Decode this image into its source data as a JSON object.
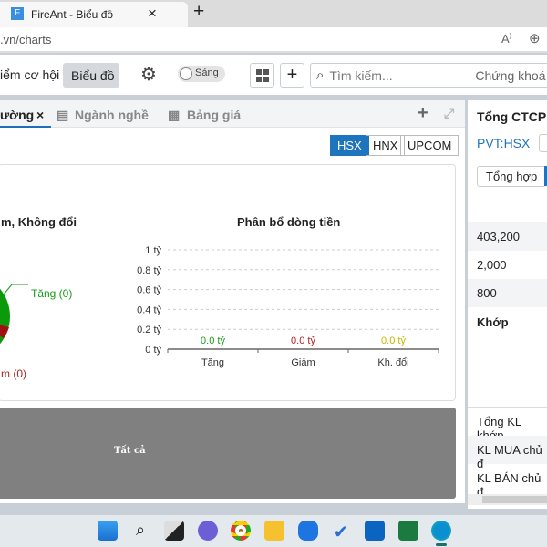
{
  "browser": {
    "tab_title": "FireAnt - Biểu đồ",
    "url": ".vn/charts",
    "new_tab": "+",
    "close": "×",
    "favicon": "F"
  },
  "toolbar": {
    "nav_partial": "iểm cơ hội",
    "chart_btn": "Biểu đồ",
    "theme_toggle": "Sáng",
    "add": "+",
    "search_placeholder": "Tìm kiếm...",
    "right_partial": "Chứng khoá"
  },
  "panel": {
    "tabs": [
      {
        "label": "ường"
      },
      {
        "label": "Ngành nghề"
      },
      {
        "label": "Bảng giá"
      }
    ],
    "exchanges": [
      "HSX",
      "HNX",
      "UPCOM"
    ],
    "active_exchange": "HSX"
  },
  "pie": {
    "title_partial": "m, Không đổi",
    "label_up": "Tăng (0)",
    "label_down": "m (0)"
  },
  "chart_data": {
    "type": "bar",
    "title": "Phân bổ dòng tiền",
    "categories": [
      "Tăng",
      "Giảm",
      "Kh. đổi"
    ],
    "values": [
      0,
      0,
      0
    ],
    "data_labels": [
      "0.0 tỷ",
      "0.0 tỷ",
      "0.0 tỷ"
    ],
    "colors": [
      "#1a9a1a",
      "#b22222",
      "#c8b400"
    ],
    "yticks": [
      "0 tỷ",
      "0.2 tỷ",
      "0.4 tỷ",
      "0.6 tỷ",
      "0.8 tỷ",
      "1 tỷ"
    ],
    "ylim": [
      0,
      1
    ]
  },
  "bottom": {
    "label": "Tất cả"
  },
  "right": {
    "title": "Tổng CTCP",
    "symbol": "PVT:HSX",
    "tab": "Tổng hợp",
    "values": [
      "403,200",
      "2,000",
      "800"
    ],
    "section": "Khớp",
    "rows": [
      "Tổng KL khớp",
      "KL MUA chủ đ",
      "KL BÁN chủ đ"
    ]
  }
}
